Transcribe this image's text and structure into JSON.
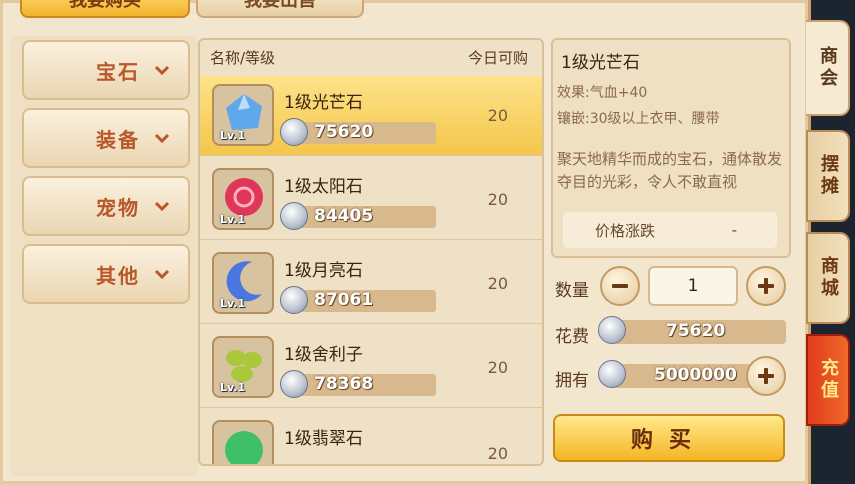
{
  "top_tabs": {
    "buy": "我要购买",
    "sell": "我要出售"
  },
  "categories": [
    {
      "label": "宝石"
    },
    {
      "label": "装备"
    },
    {
      "label": "宠物"
    },
    {
      "label": "其他"
    }
  ],
  "list": {
    "header_name": "名称/等级",
    "header_qty": "今日可购",
    "items": [
      {
        "name": "1级光芒石",
        "level": "Lv.1",
        "price": "75620",
        "qty": "20",
        "color": "#5fa8ea"
      },
      {
        "name": "1级太阳石",
        "level": "Lv.1",
        "price": "84405",
        "qty": "20",
        "color": "#e0365a"
      },
      {
        "name": "1级月亮石",
        "level": "Lv.1",
        "price": "87061",
        "qty": "20",
        "color": "#4a76e0"
      },
      {
        "name": "1级舍利子",
        "level": "Lv.1",
        "price": "78368",
        "qty": "20",
        "color": "#a9c83a"
      },
      {
        "name": "1级翡翠石",
        "level": "",
        "price": "",
        "qty": "20",
        "color": "#3fbf6a"
      }
    ]
  },
  "detail": {
    "title": "1级光芒石",
    "effect": "效果:气血+40",
    "inlay": "镶嵌:30级以上衣甲、腰带",
    "description": "聚天地精华而成的宝石，通体散发夺目的光彩，令人不敢直视",
    "price_change_label": "价格涨跌",
    "price_change_value": "-"
  },
  "purchase": {
    "qty_label": "数量",
    "qty_value": "1",
    "cost_label": "花费",
    "cost_value": "75620",
    "own_label": "拥有",
    "own_value": "5000000",
    "buy_label": "购买"
  },
  "side_tabs": [
    "商会",
    "摆摊",
    "商城",
    "充值"
  ]
}
